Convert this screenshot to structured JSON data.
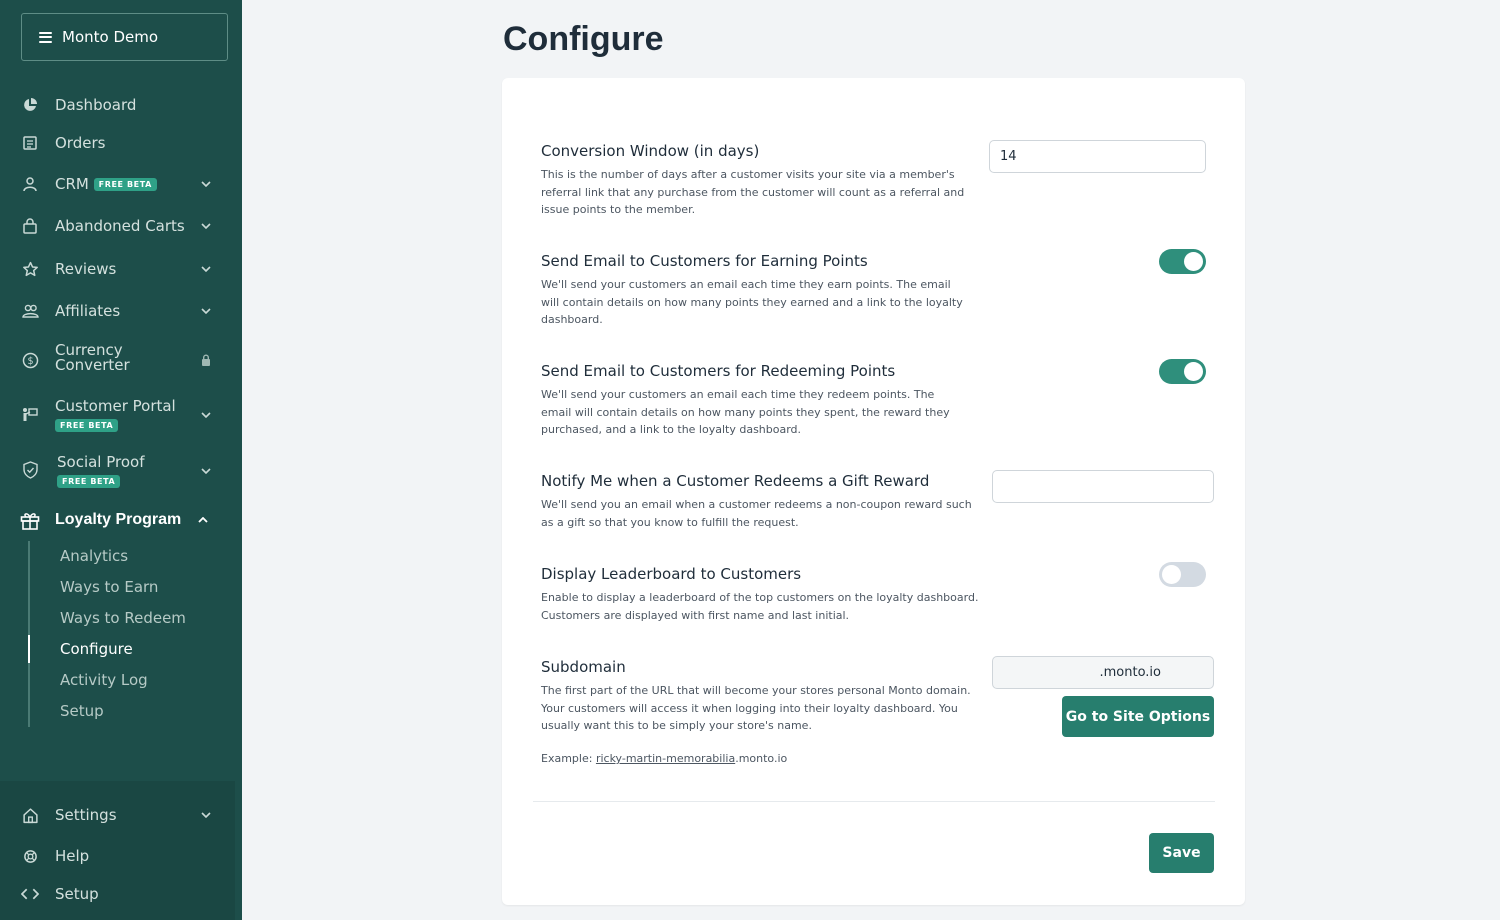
{
  "sidebar": {
    "store_name": "Monto Demo",
    "badge_text": "FREE BETA",
    "items": [
      {
        "label": "Dashboard",
        "icon": "pie-chart-icon"
      },
      {
        "label": "Orders",
        "icon": "receipt-icon"
      },
      {
        "label": "CRM",
        "icon": "user-icon",
        "badge": "FREE BETA"
      },
      {
        "label": "Abandoned Carts",
        "icon": "shopping-bag-icon"
      },
      {
        "label": "Reviews",
        "icon": "star-icon"
      },
      {
        "label": "Affiliates",
        "icon": "users-icon"
      },
      {
        "label_line1": "Currency",
        "label_line2": "Converter",
        "icon": "dollar-icon",
        "locked": true
      },
      {
        "label": "Customer Portal",
        "icon": "portal-icon",
        "badge": "FREE BETA"
      },
      {
        "label": "Social Proof",
        "icon": "shield-icon",
        "badge": "FREE BETA"
      },
      {
        "label": "Loyalty Program",
        "icon": "gift-icon",
        "expanded": true
      }
    ],
    "loyalty_sub": [
      "Analytics",
      "Ways to Earn",
      "Ways to Redeem",
      "Configure",
      "Activity Log",
      "Setup"
    ],
    "active_sub": "Configure",
    "bottom_items": [
      {
        "label": "Settings",
        "icon": "home-icon"
      },
      {
        "label": "Help",
        "icon": "lifebuoy-icon"
      },
      {
        "label": "Setup",
        "icon": "code-icon"
      }
    ]
  },
  "page": {
    "title": "Configure"
  },
  "settings": {
    "conversion": {
      "title": "Conversion Window (in days)",
      "desc": "This is the number of days after a customer visits your site via a member's referral link that any purchase from the customer will count as a referral and issue points to the member.",
      "value": "14"
    },
    "earning_email": {
      "title": "Send Email to Customers for Earning Points",
      "desc": "We'll send your customers an email each time they earn points. The email will contain details on how many points they earned and a link to the loyalty dashboard.",
      "enabled": true
    },
    "redeeming_email": {
      "title": "Send Email to Customers for Redeeming Points",
      "desc": "We'll send your customers an email each time they redeem points. The email will contain details on how many points they spent, the reward they purchased, and a link to the loyalty dashboard.",
      "enabled": true
    },
    "notify": {
      "title": "Notify Me when a Customer Redeems a Gift Reward",
      "desc": "We'll send you an email when a customer redeems a non-coupon reward such as a gift so that you know to fulfill the request.",
      "value": ""
    },
    "leaderboard": {
      "title": "Display Leaderboard to Customers",
      "desc": "Enable to display a leaderboard of the top customers on the loyalty dashboard. Customers are displayed with first name and last initial.",
      "enabled": false
    },
    "subdomain": {
      "title": "Subdomain",
      "desc": "The first part of the URL that will become your stores personal Monto domain. Your customers will access it when logging into their loyalty dashboard. You usually want this to be simply your store's name.",
      "suffix": ".monto.io",
      "button": "Go to Site Options",
      "example_prefix": "Example: ",
      "example_link": "ricky-martin-memorabilia",
      "example_suffix": ".monto.io"
    }
  },
  "save_label": "Save",
  "colors": {
    "sidebar": "#1d4e4a",
    "accent": "#277e6e",
    "badge": "#2fa187"
  }
}
